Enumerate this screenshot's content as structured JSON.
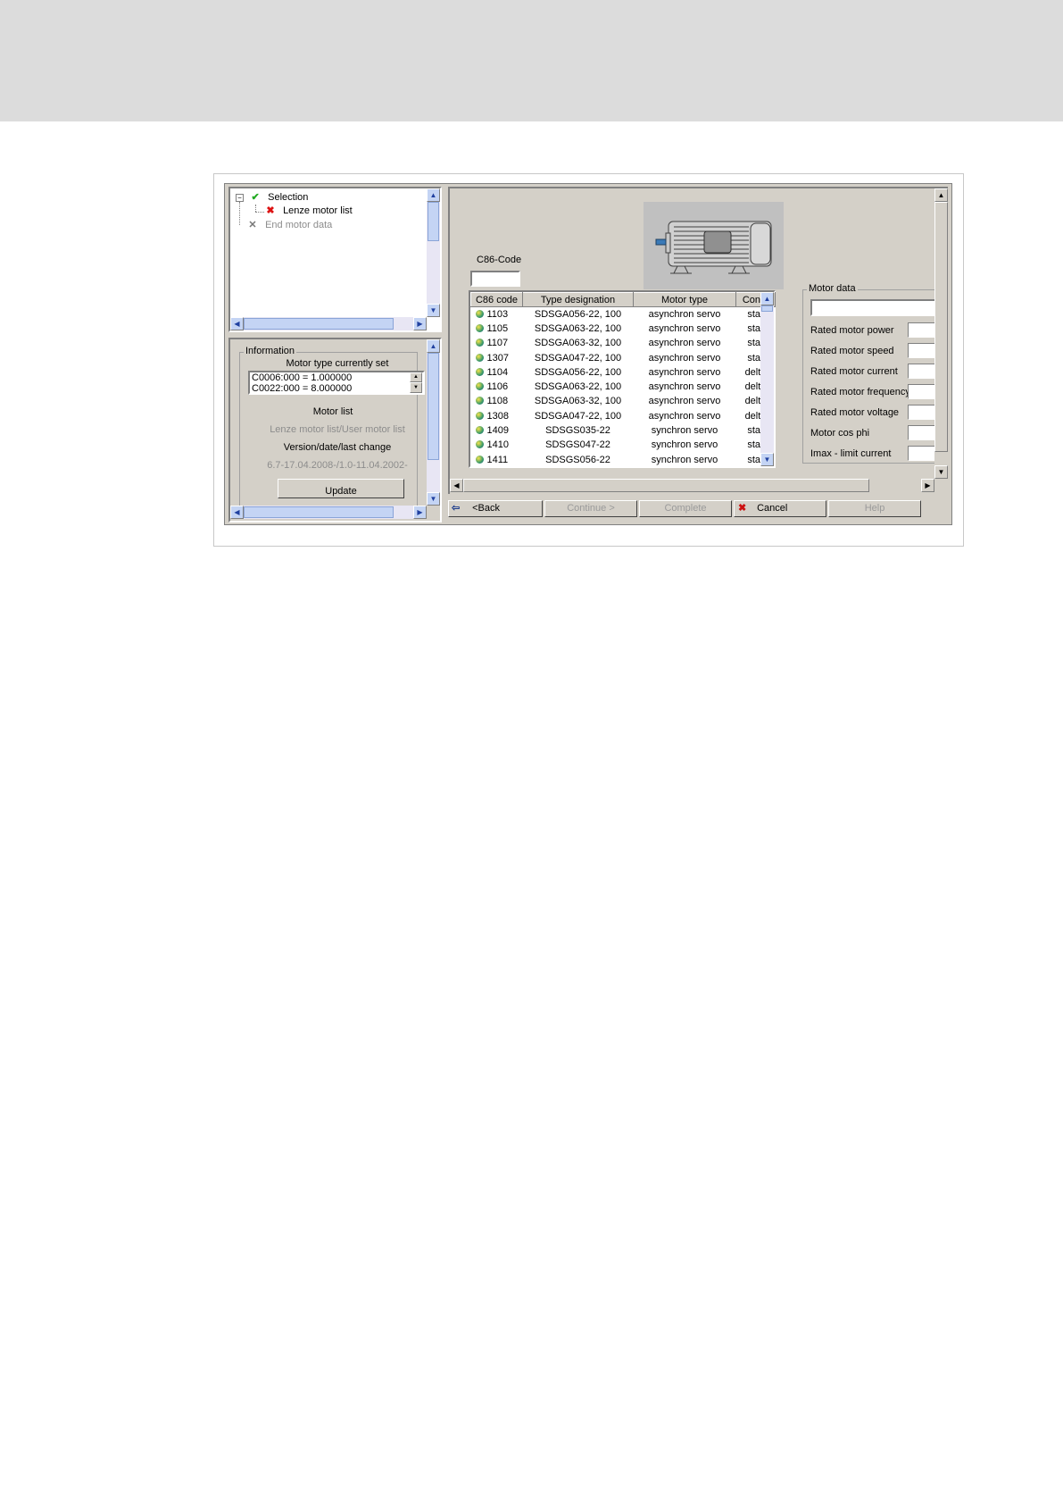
{
  "tree": {
    "items": [
      {
        "label": "Selection",
        "icon": "checkmark-icon",
        "state": "done"
      },
      {
        "label": "Lenze motor list",
        "icon": "cross-icon",
        "state": "current"
      },
      {
        "label": "End motor data",
        "icon": "tools-icon",
        "state": "disabled"
      }
    ],
    "collapse_glyph": "−"
  },
  "info": {
    "title": "Information",
    "motor_type_heading": "Motor type currently set",
    "codes": [
      "C0006:000 = 1.000000",
      "C0022:000 = 8.000000"
    ],
    "motor_list_heading": "Motor list",
    "motor_list_value": "Lenze motor list/User motor list",
    "version_heading": "Version/date/last change",
    "version_value": "6.7-17.04.2008-/1.0-11.04.2002-",
    "update_label": "Update"
  },
  "c86": {
    "label": "C86-Code",
    "value": ""
  },
  "motor_list": {
    "columns": [
      "C86 code",
      "Type designation",
      "Motor type",
      "Con..."
    ],
    "rows": [
      {
        "code": "1103",
        "type": "SDSGA056-22, 100",
        "motor_type": "asynchron servo",
        "con": "star"
      },
      {
        "code": "1105",
        "type": "SDSGA063-22, 100",
        "motor_type": "asynchron servo",
        "con": "star"
      },
      {
        "code": "1107",
        "type": "SDSGA063-32, 100",
        "motor_type": "asynchron servo",
        "con": "star"
      },
      {
        "code": "1307",
        "type": "SDSGA047-22, 100",
        "motor_type": "asynchron servo",
        "con": "star"
      },
      {
        "code": "1104",
        "type": "SDSGA056-22, 100",
        "motor_type": "asynchron servo",
        "con": "delta"
      },
      {
        "code": "1106",
        "type": "SDSGA063-22, 100",
        "motor_type": "asynchron servo",
        "con": "delta"
      },
      {
        "code": "1108",
        "type": "SDSGA063-32, 100",
        "motor_type": "asynchron servo",
        "con": "delta"
      },
      {
        "code": "1308",
        "type": "SDSGA047-22, 100",
        "motor_type": "asynchron servo",
        "con": "delta"
      },
      {
        "code": "1409",
        "type": "SDSGS035-22",
        "motor_type": "synchron servo",
        "con": "star"
      },
      {
        "code": "1410",
        "type": "SDSGS047-22",
        "motor_type": "synchron servo",
        "con": "star"
      },
      {
        "code": "1411",
        "type": "SDSGS056-22",
        "motor_type": "synchron servo",
        "con": "star"
      }
    ]
  },
  "motor_data": {
    "title": "Motor data",
    "name_value": "",
    "fields": [
      {
        "label": "Rated motor power",
        "value": ""
      },
      {
        "label": "Rated motor speed",
        "value": ""
      },
      {
        "label": "Rated motor current",
        "value": ""
      },
      {
        "label": "Rated motor frequency",
        "value": ""
      },
      {
        "label": "Rated motor voltage",
        "value": ""
      },
      {
        "label": "Motor cos phi",
        "value": ""
      },
      {
        "label": "Imax - limit current",
        "value": ""
      }
    ]
  },
  "buttons": {
    "back": "<Back",
    "continue": "Continue >",
    "complete": "Complete",
    "cancel": "Cancel",
    "help": "Help"
  },
  "scroll_glyphs": {
    "up": "▲",
    "down": "▼",
    "left": "◀",
    "right": "▶",
    "grip": "≡"
  },
  "colors": {
    "check": "#22aa22",
    "cross": "#dd1111",
    "band": "#dcdcdc",
    "dialog": "#d4d0c8"
  }
}
